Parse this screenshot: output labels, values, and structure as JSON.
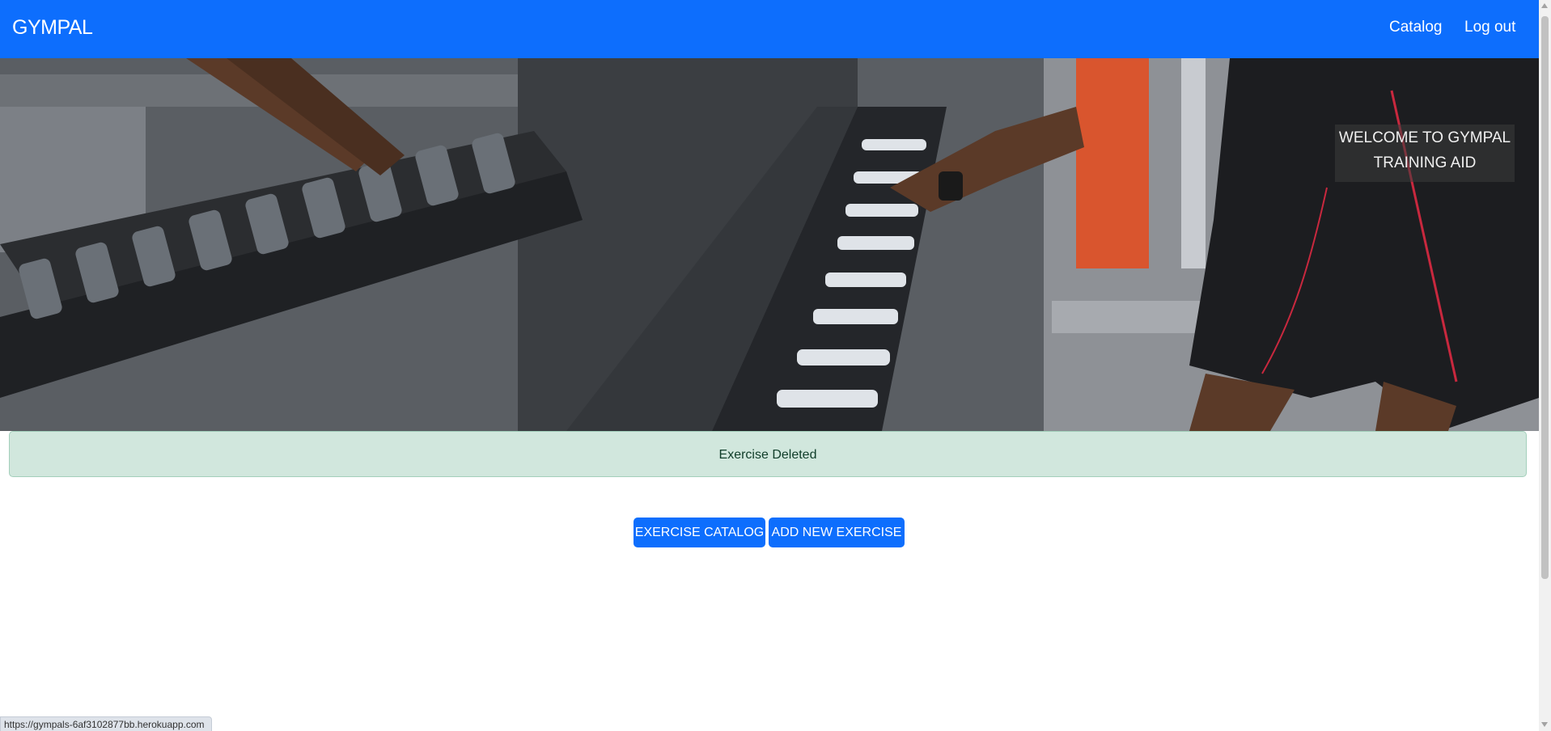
{
  "navbar": {
    "brand": "GYMPAL",
    "links": [
      "Catalog",
      "Log out"
    ]
  },
  "hero": {
    "image": "gym-dumbbell-rack-photo",
    "welcome_line1": "WELCOME TO GYMPAL",
    "welcome_line2": "TRAINING AID"
  },
  "alert": {
    "message": "Exercise Deleted",
    "color": "#d1e7dd"
  },
  "actions": {
    "exercise_catalog": "EXERCISE CATALOG",
    "add_new_exercise": "ADD NEW EXERCISE"
  },
  "status_bar": {
    "url": "https://gympals-6af3102877bb.herokuapp.com"
  },
  "colors": {
    "primary": "#0d6efd",
    "alert_text": "#0f3d29"
  }
}
